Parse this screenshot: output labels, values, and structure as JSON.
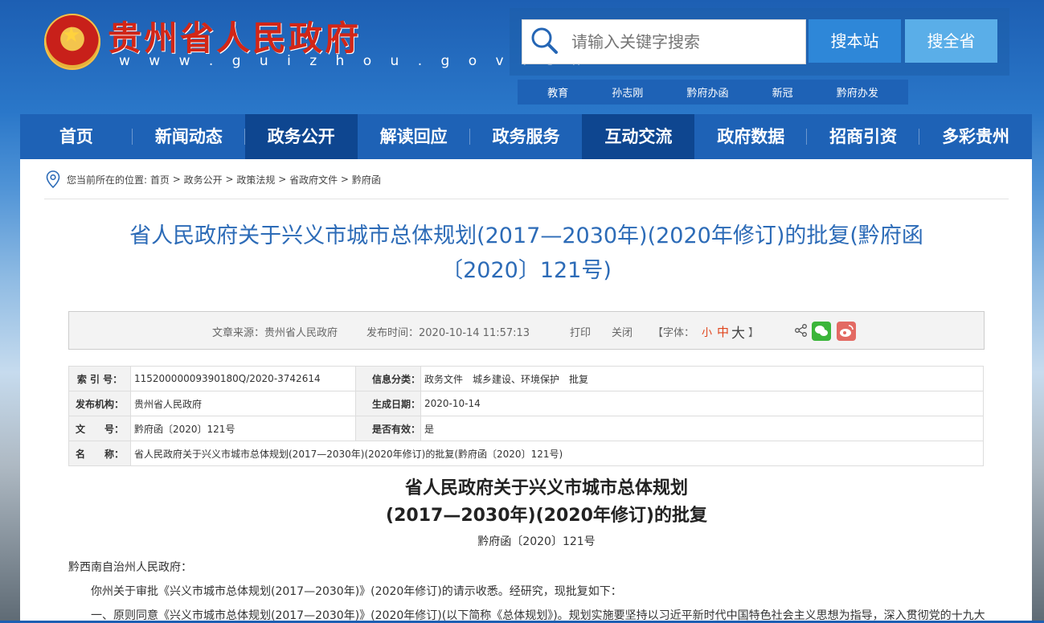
{
  "header": {
    "site_name": "贵州省人民政府",
    "site_url": "w w w . g u i z h o u . g o v . c n"
  },
  "search": {
    "placeholder": "请输入关键字搜索",
    "btn_local": "搜本站",
    "btn_all": "搜全省"
  },
  "hot_links": [
    "教育",
    "孙志刚",
    "黔府办函",
    "新冠",
    "黔府办发"
  ],
  "nav": [
    "首页",
    "新闻动态",
    "政务公开",
    "解读回应",
    "政务服务",
    "互动交流",
    "政府数据",
    "招商引资",
    "多彩贵州"
  ],
  "breadcrumb": {
    "prefix": "您当前所在的位置:",
    "items": [
      "首页",
      "政务公开",
      "政策法规",
      "省政府文件",
      "黔府函"
    ],
    "sep": ">"
  },
  "article": {
    "title_line1": "省人民政府关于兴义市城市总体规划(2017—2030年)(2020年修订)的批复(黔府函",
    "title_line2": "〔2020〕121号)"
  },
  "meta": {
    "source": "文章来源：贵州省人民政府",
    "pubtime": "发布时间：2020-10-14 11:57:13",
    "print": "打印",
    "close": "关闭",
    "font_label": "【字体：",
    "font_small": "小",
    "font_mid": "中",
    "font_large": "大",
    "font_end": "】"
  },
  "info": {
    "index_label": "索 引 号：",
    "index_value": "11520000009390180Q/2020-3742614",
    "category_label": "信息分类：",
    "category_value": "政务文件　城乡建设、环境保护　批复",
    "issuer_label": "发布机构：",
    "issuer_value": "贵州省人民政府",
    "date_label": "生成日期：",
    "date_value": "2020-10-14",
    "docno_label": "文　　号：",
    "docno_value": "黔府函〔2020〕121号",
    "valid_label": "是否有效：",
    "valid_value": "是",
    "name_label": "名　　称：",
    "name_value": "省人民政府关于兴义市城市总体规划(2017—2030年)(2020年修订)的批复(黔府函〔2020〕121号)"
  },
  "doc": {
    "title_line1": "省人民政府关于兴义市城市总体规划",
    "title_line2": "(2017—2030年)(2020年修订)的批复",
    "number": "黔府函〔2020〕121号",
    "addressee": "黔西南自治州人民政府：",
    "p1": "你州关于审批《兴义市城市总体规划(2017—2030年)》(2020年修订)的请示收悉。经研究，现批复如下：",
    "p2": "一、原则同意《兴义市城市总体规划(2017—2030年)》(2020年修订)(以下简称《总体规划》)。规划实施要坚持以习近平新时代中国特色社会主义思想为指导，深入贯彻党的十九大"
  }
}
